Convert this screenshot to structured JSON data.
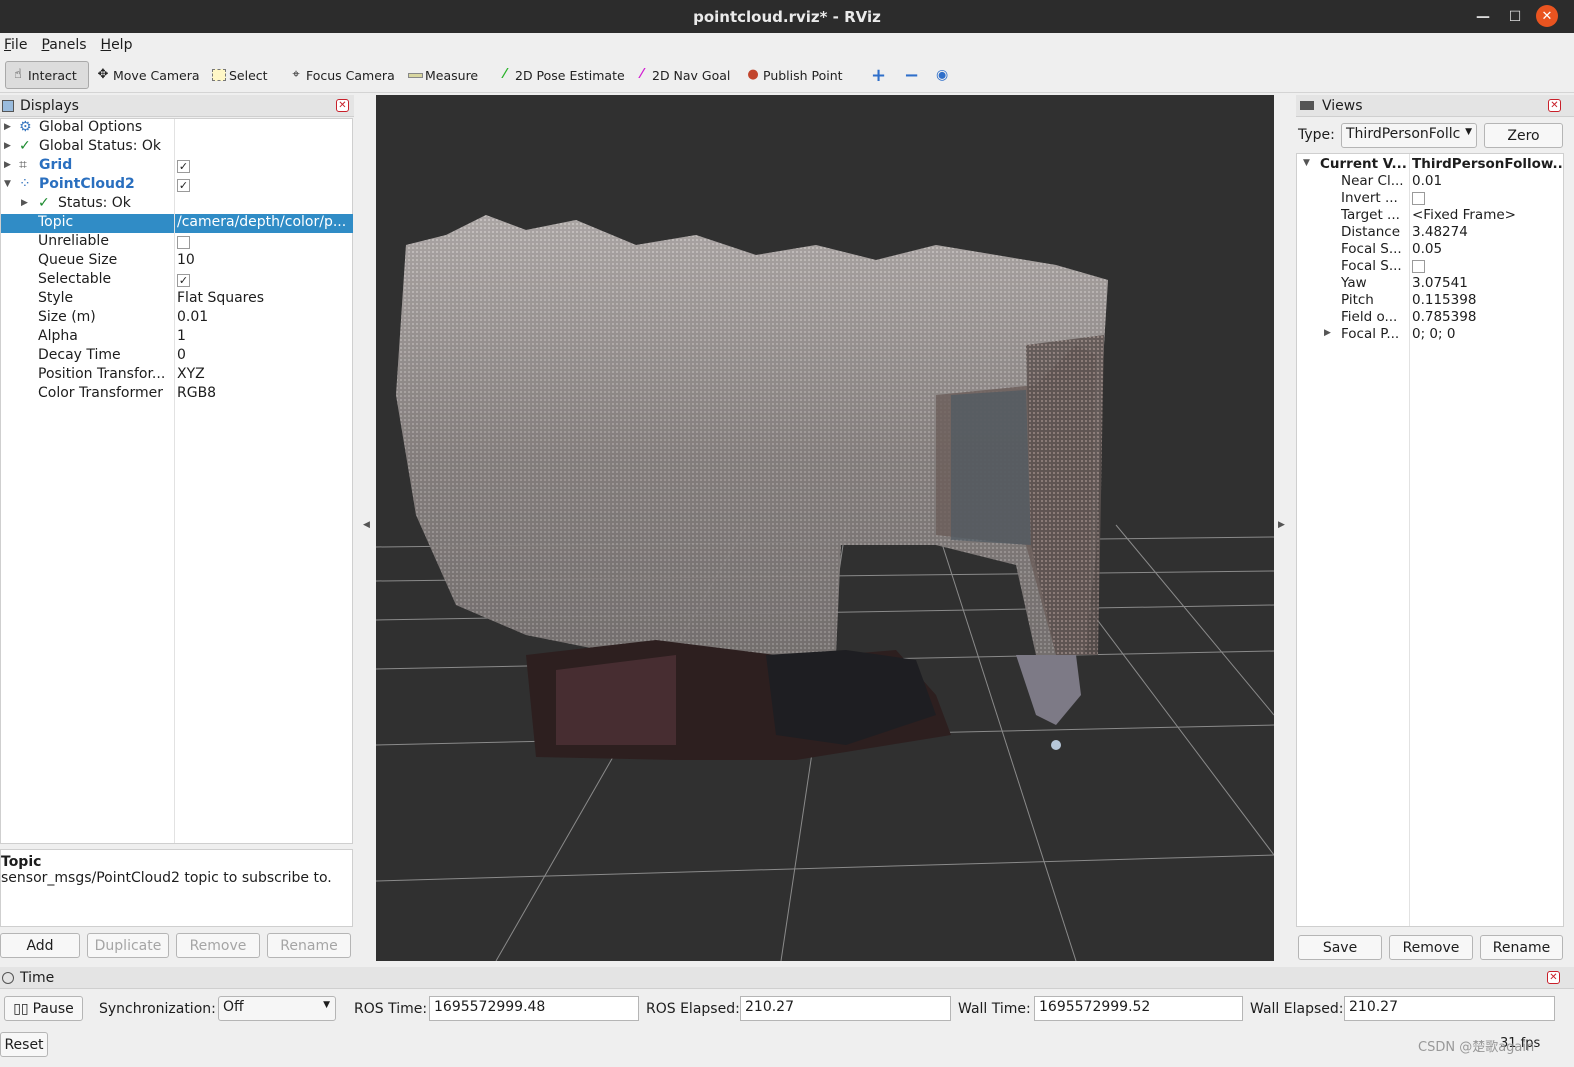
{
  "window": {
    "title": "pointcloud.rviz* - RViz",
    "minimize": "—",
    "maximize": "☐",
    "close": "✕"
  },
  "menu": [
    "File",
    "Panels",
    "Help"
  ],
  "toolbar": {
    "interact": "Interact",
    "move_camera": "Move Camera",
    "select": "Select",
    "focus_camera": "Focus Camera",
    "measure": "Measure",
    "pose_estimate": "2D Pose Estimate",
    "nav_goal": "2D Nav Goal",
    "publish_point": "Publish Point"
  },
  "displays": {
    "title": "Displays",
    "rows": {
      "global_options": "Global Options",
      "global_status": "Global Status: Ok",
      "grid": "Grid",
      "pointcloud": "PointCloud2",
      "status": "Status: Ok",
      "topic_k": "Topic",
      "topic_v": "/camera/depth/color/p...",
      "unreliable_k": "Unreliable",
      "queue_k": "Queue Size",
      "queue_v": "10",
      "selectable_k": "Selectable",
      "style_k": "Style",
      "style_v": "Flat Squares",
      "size_k": "Size (m)",
      "size_v": "0.01",
      "alpha_k": "Alpha",
      "alpha_v": "1",
      "decay_k": "Decay Time",
      "decay_v": "0",
      "pos_k": "Position Transfor...",
      "pos_v": "XYZ",
      "color_k": "Color Transformer",
      "color_v": "RGB8"
    },
    "desc_title": "Topic",
    "desc_text": "sensor_msgs/PointCloud2 topic to subscribe to.",
    "buttons": {
      "add": "Add",
      "duplicate": "Duplicate",
      "remove": "Remove",
      "rename": "Rename"
    }
  },
  "views": {
    "title": "Views",
    "type_label": "Type:",
    "type_value": "ThirdPersonFollc",
    "zero": "Zero",
    "current_k": "Current V...",
    "current_v": "ThirdPersonFollow...",
    "props": [
      {
        "k": "Near Cl...",
        "v": "0.01"
      },
      {
        "k": "Invert ...",
        "v": ""
      },
      {
        "k": "Target ...",
        "v": "<Fixed Frame>"
      },
      {
        "k": "Distance",
        "v": "3.48274"
      },
      {
        "k": "Focal S...",
        "v": "0.05"
      },
      {
        "k": "Focal S...",
        "v": ""
      },
      {
        "k": "Yaw",
        "v": "3.07541"
      },
      {
        "k": "Pitch",
        "v": "0.115398"
      },
      {
        "k": "Field o...",
        "v": "0.785398"
      },
      {
        "k": "Focal P...",
        "v": "0; 0; 0"
      }
    ],
    "buttons": {
      "save": "Save",
      "remove": "Remove",
      "rename": "Rename"
    }
  },
  "time": {
    "title": "Time",
    "pause": "Pause",
    "sync_label": "Synchronization:",
    "sync_value": "Off",
    "ros_time_label": "ROS Time:",
    "ros_time": "1695572999.48",
    "ros_elapsed_label": "ROS Elapsed:",
    "ros_elapsed": "210.27",
    "wall_time_label": "Wall Time:",
    "wall_time": "1695572999.52",
    "wall_elapsed_label": "Wall Elapsed:",
    "wall_elapsed": "210.27",
    "reset": "Reset",
    "fps": "31 fps",
    "watermark": "CSDN @楚歌again"
  },
  "colors": {
    "accent": "#308cc6",
    "viewport_bg": "#303030",
    "titlebar": "#2c2c2c",
    "close": "#e95420"
  }
}
